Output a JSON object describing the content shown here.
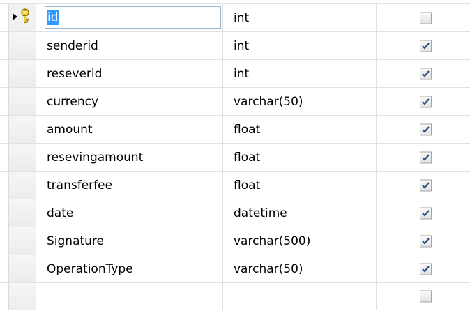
{
  "columns": [
    {
      "name": "id",
      "type": "int",
      "allow_nulls": false,
      "selected": true,
      "primary_key": true
    },
    {
      "name": "senderid",
      "type": "int",
      "allow_nulls": true
    },
    {
      "name": "reseverid",
      "type": "int",
      "allow_nulls": true
    },
    {
      "name": "currency",
      "type": "varchar(50)",
      "allow_nulls": true
    },
    {
      "name": "amount",
      "type": "float",
      "allow_nulls": true
    },
    {
      "name": "resevingamount",
      "type": "float",
      "allow_nulls": true
    },
    {
      "name": "transferfee",
      "type": "float",
      "allow_nulls": true
    },
    {
      "name": "date",
      "type": "datetime",
      "allow_nulls": true
    },
    {
      "name": "Signature",
      "type": "varchar(500)",
      "allow_nulls": true
    },
    {
      "name": "OperationType",
      "type": "varchar(50)",
      "allow_nulls": true
    },
    {
      "name": "",
      "type": "",
      "allow_nulls": false
    }
  ],
  "colors": {
    "selection": "#3399ff",
    "check": "#2a4f85",
    "key": "#e8c21d"
  },
  "icons": {
    "current_row": "row-pointer-icon",
    "primary_key": "primary-key-icon"
  }
}
